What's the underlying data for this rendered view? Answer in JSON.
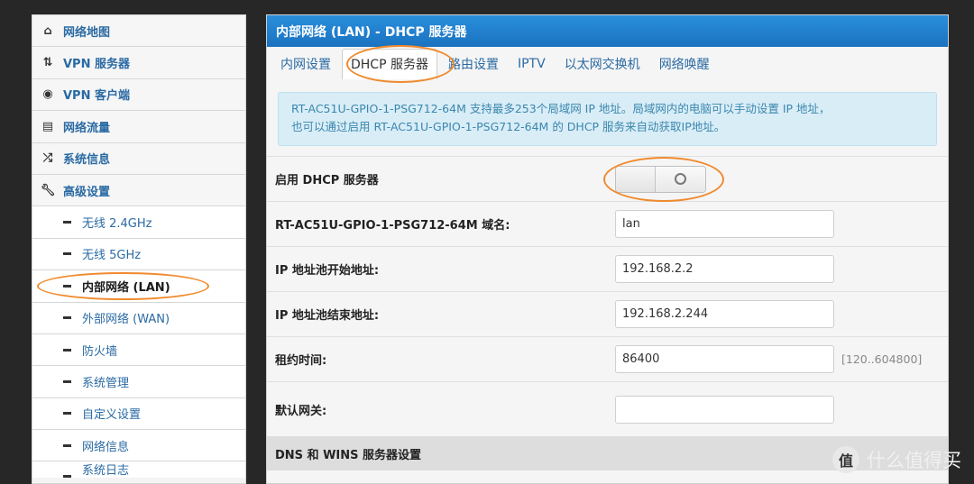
{
  "sidebar": {
    "items": [
      {
        "label": "网络地图"
      },
      {
        "label": "VPN 服务器"
      },
      {
        "label": "VPN 客户端"
      },
      {
        "label": "网络流量"
      },
      {
        "label": "系统信息"
      },
      {
        "label": "高级设置"
      }
    ],
    "sub_items": [
      {
        "label": "无线 2.4GHz"
      },
      {
        "label": "无线 5GHz"
      },
      {
        "label": "内部网络 (LAN)"
      },
      {
        "label": "外部网络 (WAN)"
      },
      {
        "label": "防火墙"
      },
      {
        "label": "系统管理"
      },
      {
        "label": "自定义设置"
      },
      {
        "label": "网络信息"
      },
      {
        "label": "系统日志"
      }
    ]
  },
  "panel": {
    "title": "内部网络 (LAN) - DHCP 服务器",
    "tabs": [
      {
        "label": "内网设置"
      },
      {
        "label": "DHCP 服务器"
      },
      {
        "label": "路由设置"
      },
      {
        "label": "IPTV"
      },
      {
        "label": "以太网交换机"
      },
      {
        "label": "网络唤醒"
      }
    ],
    "info_line1": "RT-AC51U-GPIO-1-PSG712-64M 支持最多253个局域网 IP 地址。局域网内的电脑可以手动设置 IP 地址，",
    "info_line2": "也可以通过启用 RT-AC51U-GPIO-1-PSG712-64M 的 DHCP 服务来自动获取IP地址。",
    "dhcp_enable_label": "启用 DHCP 服务器",
    "dhcp_enabled": true,
    "domain_label": "RT-AC51U-GPIO-1-PSG712-64M 域名:",
    "domain_value": "lan",
    "pool_start_label": "IP 地址池开始地址:",
    "pool_start_value": "192.168.2.2",
    "pool_end_label": "IP 地址池结束地址:",
    "pool_end_value": "192.168.2.244",
    "lease_label": "租约时间:",
    "lease_value": "86400",
    "lease_hint": "[120..604800]",
    "gateway_label": "默认网关:",
    "gateway_value": "",
    "dns_section": "DNS 和 WINS 服务器设置"
  },
  "watermark": {
    "badge": "值",
    "text": "什么值得买"
  },
  "colors": {
    "header_blue": "#1a72c0",
    "link_blue": "#2a6aa3",
    "annotation_orange": "#f08a2e",
    "info_bg": "#d9edf7"
  }
}
